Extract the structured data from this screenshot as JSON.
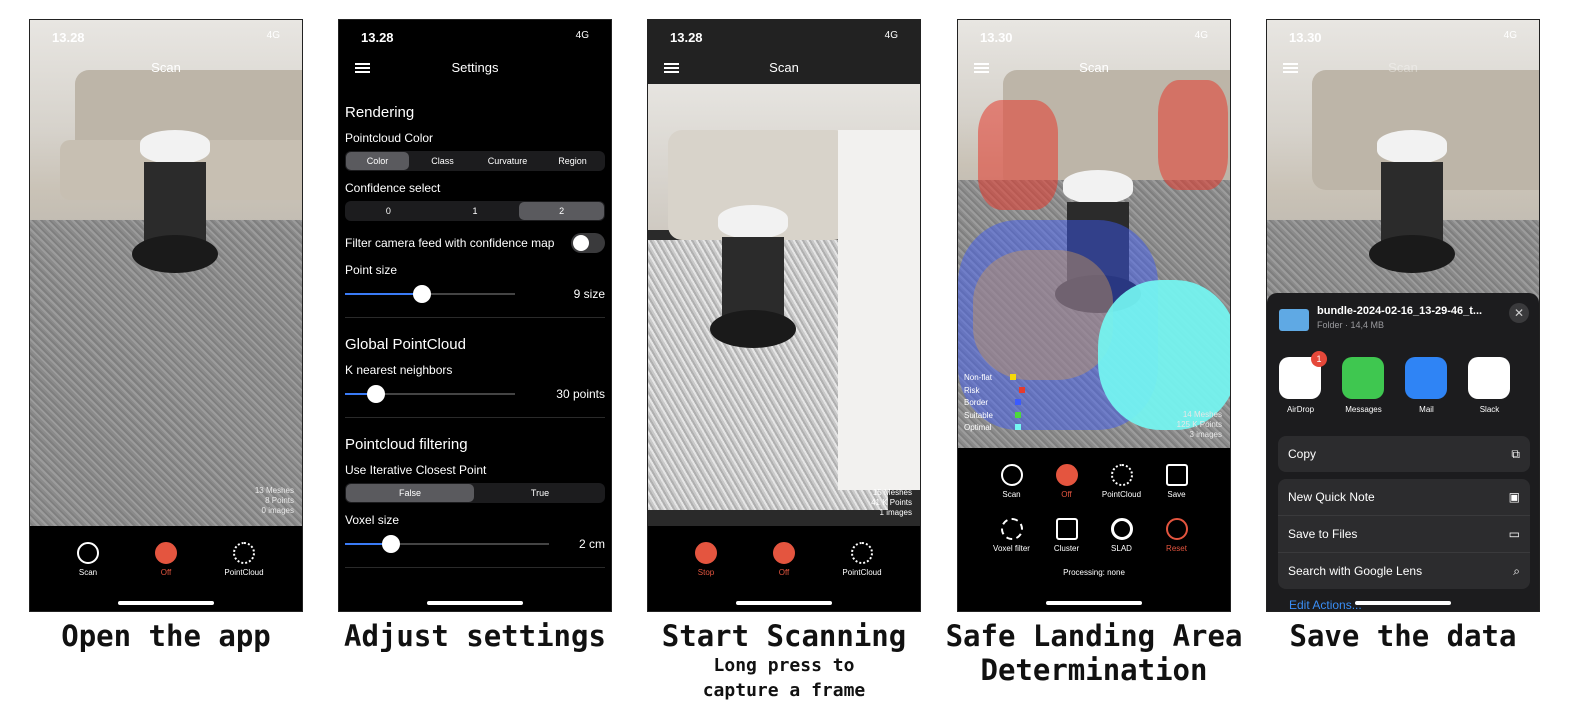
{
  "panels": [
    {
      "caption": "Open the app",
      "time": "13.28",
      "network": "4G",
      "title": "Scan",
      "stats": [
        "13 Meshes",
        "8 Points",
        "0 images"
      ],
      "tools": [
        {
          "label": "Scan",
          "icon": "play-icon"
        },
        {
          "label": "Off",
          "icon": "camera-icon"
        },
        {
          "label": "PointCloud",
          "icon": "pointcloud-icon"
        }
      ]
    },
    {
      "caption": "Adjust settings",
      "time": "13.28",
      "network": "4G",
      "title": "Settings",
      "rendering": {
        "title": "Rendering",
        "pointcloud_color_label": "Pointcloud Color",
        "color_options": [
          "Color",
          "Class",
          "Curvature",
          "Region"
        ],
        "color_selected": "Color",
        "confidence_label": "Confidence select",
        "confidence_options": [
          "0",
          "1",
          "2"
        ],
        "confidence_selected": "2",
        "filter_label": "Filter camera feed with confidence map",
        "filter_on": false,
        "point_size_label": "Point size",
        "point_size_value": "9 size",
        "point_size_fraction": 0.55
      },
      "global": {
        "title": "Global PointCloud",
        "knn_label": "K nearest neighbors",
        "knn_value": "30 points",
        "knn_fraction": 0.2
      },
      "filtering": {
        "title": "Pointcloud filtering",
        "icp_label": "Use Iterative Closest Point",
        "icp_options": [
          "False",
          "True"
        ],
        "icp_selected": "False",
        "voxel_label": "Voxel size",
        "voxel_value": "2 cm",
        "voxel_fraction": 0.22
      }
    },
    {
      "caption": "Start Scanning",
      "subcaption": "Long press to capture a frame",
      "time": "13.28",
      "network": "4G",
      "title": "Scan",
      "stats": [
        "15 Meshes",
        "41 K Points",
        "1 images"
      ],
      "tools": [
        {
          "label": "Stop",
          "icon": "stop-icon"
        },
        {
          "label": "Off",
          "icon": "camera-icon"
        },
        {
          "label": "PointCloud",
          "icon": "pointcloud-icon"
        }
      ]
    },
    {
      "caption": "Safe Landing Area Determination",
      "time": "13.30",
      "network": "4G",
      "title": "Scan",
      "legend": [
        {
          "label": "Non-flat",
          "color": "#f5d90a"
        },
        {
          "label": "Risk",
          "color": "#e63b2e"
        },
        {
          "label": "Border",
          "color": "#3b5bff"
        },
        {
          "label": "Suitable",
          "color": "#4cd83c"
        },
        {
          "label": "Optimal",
          "color": "#74f6f2"
        }
      ],
      "stats": [
        "14 Meshes",
        "125 K Points",
        "3 images"
      ],
      "tools_row1": [
        {
          "label": "Scan",
          "icon": "play-icon"
        },
        {
          "label": "Off",
          "icon": "camera-icon"
        },
        {
          "label": "PointCloud",
          "icon": "pointcloud-icon"
        },
        {
          "label": "Save",
          "icon": "save-icon"
        }
      ],
      "tools_row2": [
        {
          "label": "Voxel filter",
          "icon": "voxel-filter-icon"
        },
        {
          "label": "Cluster",
          "icon": "cluster-icon"
        },
        {
          "label": "SLAD",
          "icon": "slad-icon"
        },
        {
          "label": "Reset",
          "icon": "reset-icon"
        }
      ],
      "processing": "Processing: none"
    },
    {
      "caption": "Save the data",
      "time": "13.30",
      "network": "4G",
      "title": "Scan",
      "share": {
        "file_name": "bundle-2024-02-16_13-29-46_t...",
        "file_meta": "Folder · 14,4 MB",
        "apps": [
          {
            "label": "AirDrop",
            "badge": "1",
            "color": "#ffffff"
          },
          {
            "label": "Messages",
            "color": "#3fc750"
          },
          {
            "label": "Mail",
            "color": "#2f84f5"
          },
          {
            "label": "Slack",
            "color": "#ffffff"
          }
        ],
        "actions_a": [
          {
            "label": "Copy",
            "icon": "copy-icon"
          }
        ],
        "actions_b": [
          {
            "label": "New Quick Note",
            "icon": "quick-note-icon"
          },
          {
            "label": "Save to Files",
            "icon": "folder-icon"
          },
          {
            "label": "Search with Google Lens",
            "icon": "search-icon"
          }
        ],
        "edit_actions": "Edit Actions..."
      }
    }
  ]
}
